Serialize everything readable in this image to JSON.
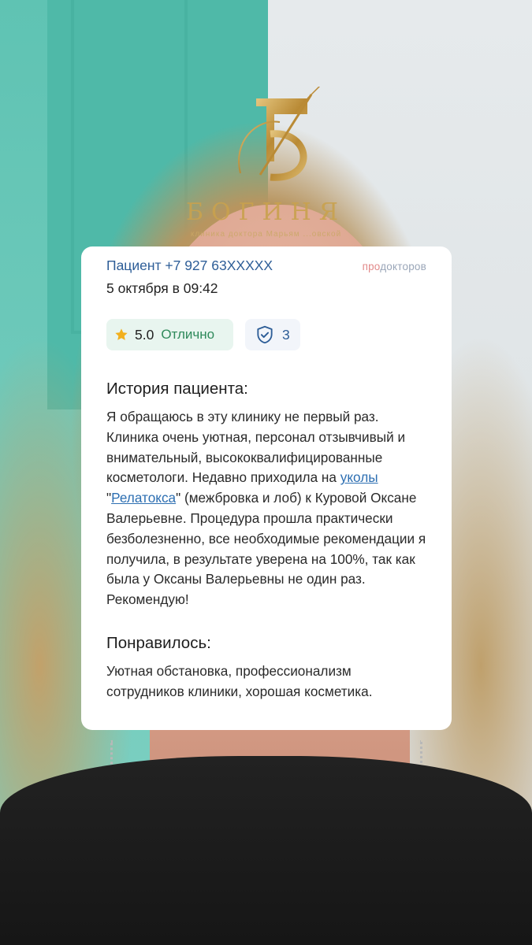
{
  "logo": {
    "wordmark": "БОГИНЯ",
    "subtitle": "клиника доктора Марьям ...овской"
  },
  "review": {
    "patient": "Пациент +7 927 63XXXXX",
    "brand_part1": "про",
    "brand_part2": "докторов",
    "date": "5 октября в 09:42",
    "rating_value": "5.0",
    "rating_word": "Отлично",
    "verified_count": "3",
    "story_title": "История пациента:",
    "story_part1": "Я обращаюсь в эту клинику не первый раз. Клиника очень уютная, персонал отзывчивый и внимательный, высококвалифицированные косметологи. Недавно приходила на ",
    "story_link1": "уколы",
    "story_part2": " \"",
    "story_link2": "Релатокса",
    "story_part3": "\" (межбровка и лоб) к Куровой Оксане Валерьевне. Процедура прошла практически безболезненно, все необходимые рекомендации я получила, в результате уверена на 100%, так как была у Оксаны Валерьевны не один раз. Рекомендую!",
    "liked_title": "Понравилось:",
    "liked_text": "Уютная обстановка, профессионализм сотрудников клиники, хорошая косметика."
  },
  "colors": {
    "link": "#2d6fb2",
    "accent_blue": "#2d5d97",
    "rating_green": "#2f8a5b",
    "star": "#f2b01e",
    "logo_gold": "#c9a24e"
  },
  "icons": {
    "star": "star-icon",
    "shield": "shield-check-icon"
  }
}
